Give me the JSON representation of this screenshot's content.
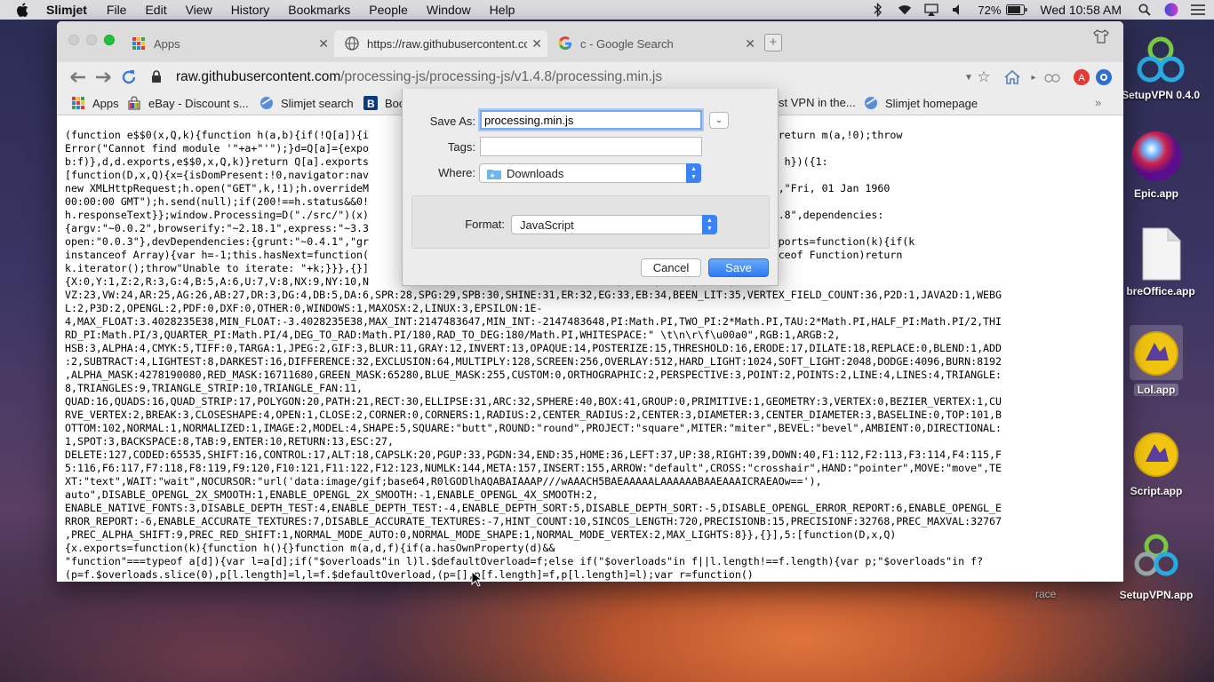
{
  "menubar": {
    "app_name": "Slimjet",
    "items": [
      "File",
      "Edit",
      "View",
      "History",
      "Bookmarks",
      "People",
      "Window",
      "Help"
    ],
    "battery": "72%",
    "clock": "Wed 10:58 AM"
  },
  "tabs": [
    {
      "title": "Apps",
      "icon": "apps-grid-icon"
    },
    {
      "title": "https://raw.githubusercontent.co",
      "icon": "globe-icon"
    },
    {
      "title": "c - Google Search",
      "icon": "google-icon"
    }
  ],
  "address": {
    "host": "raw.githubusercontent.com",
    "path": "/processing-js/processing-js/v1.4.8/processing.min.js"
  },
  "bookmarks": [
    {
      "label": "Apps",
      "icon": "apps-grid-icon"
    },
    {
      "label": "eBay - Discount s...",
      "icon": "ebay-icon"
    },
    {
      "label": "Slimjet search",
      "icon": "slimjet-icon"
    },
    {
      "label": "Boo",
      "icon": "booking-icon"
    },
    {
      "label": "st VPN in the...",
      "icon": "vpn-icon"
    },
    {
      "label": "Slimjet homepage",
      "icon": "slimjet-icon"
    }
  ],
  "code_text": "(function e$$0(x,Q,k){function h(a,b){if(!Q[a]){i                                        !b&&d)return d(a,!0);if(m)return m(a,!0);throw\nError(\"Cannot find module '\"+a+\"'\");}d=Q[a]={expo                                        l][f];return h(b?\nb:f)},d,d.exports,e$$0,x,Q,k)}return Q[a].exports                                        .length;n++)h(k[n]);return h})({1:\n[function(D,x,Q){x={isDomPresent:!0,navigator:nav                                        ){var h=\nnew XMLHttpRequest;h.open(\"GET\",k,!1);h.overrideM                                        Header(\"If-Modified-Since\",\"Fri, 01 Jan 1960\n00:00:00 GMT\");h.send(null);if(200!==h.status&&0!                                        h.status;return\nh.responseText}};window.Processing=D(\"./src/\")(x)                                        rocessing.js\",version:\"1.4.8\",dependencies:\n{argv:\"~0.0.2\",browserify:\"~2.18.1\",express:\"~3.3                                        \nopen:\"0.0.3\"},devDependencies:{grunt:\"~0.4.1\",\"gr                                        }],3:[function(D,x,Q){x.exports=function(k){if(k\ninstanceof Array){var h=-1;this.hasNext=function(                                        }else{if(k.iterator instanceof Function)return\nk.iterator();throw\"Unable to iterate: \"+k;}}},{}]\n{X:0,Y:1,Z:2,R:3,G:4,B:5,A:6,U:7,V:8,NX:9,NY:10,N                                        ,TZ:20,VX:21,VY:22,\nVZ:23,VW:24,AR:25,AG:26,AB:27,DR:3,DG:4,DB:5,DA:6,SPR:28,SPG:29,SPB:30,SHINE:31,ER:32,EG:33,EB:34,BEEN_LIT:35,VERTEX_FIELD_COUNT:36,P2D:1,JAVA2D:1,WEBG\nL:2,P3D:2,OPENGL:2,PDF:0,DXF:0,OTHER:0,WINDOWS:1,MAXOSX:2,LINUX:3,EPSILON:1E-\n4,MAX_FLOAT:3.4028235E38,MIN_FLOAT:-3.4028235E38,MAX_INT:2147483647,MIN_INT:-2147483648,PI:Math.PI,TWO_PI:2*Math.PI,TAU:2*Math.PI,HALF_PI:Math.PI/2,THI\nRD_PI:Math.PI/3,QUARTER_PI:Math.PI/4,DEG_TO_RAD:Math.PI/180,RAD_TO_DEG:180/Math.PI,WHITESPACE:\" \\t\\n\\r\\f\\u00a0\",RGB:1,ARGB:2,\nHSB:3,ALPHA:4,CMYK:5,TIFF:0,TARGA:1,JPEG:2,GIF:3,BLUR:11,GRAY:12,INVERT:13,OPAQUE:14,POSTERIZE:15,THRESHOLD:16,ERODE:17,DILATE:18,REPLACE:0,BLEND:1,ADD\n:2,SUBTRACT:4,LIGHTEST:8,DARKEST:16,DIFFERENCE:32,EXCLUSION:64,MULTIPLY:128,SCREEN:256,OVERLAY:512,HARD_LIGHT:1024,SOFT_LIGHT:2048,DODGE:4096,BURN:8192\n,ALPHA_MASK:4278190080,RED_MASK:16711680,GREEN_MASK:65280,BLUE_MASK:255,CUSTOM:0,ORTHOGRAPHIC:2,PERSPECTIVE:3,POINT:2,POINTS:2,LINE:4,LINES:4,TRIANGLE:\n8,TRIANGLES:9,TRIANGLE_STRIP:10,TRIANGLE_FAN:11,\nQUAD:16,QUADS:16,QUAD_STRIP:17,POLYGON:20,PATH:21,RECT:30,ELLIPSE:31,ARC:32,SPHERE:40,BOX:41,GROUP:0,PRIMITIVE:1,GEOMETRY:3,VERTEX:0,BEZIER_VERTEX:1,CU\nRVE_VERTEX:2,BREAK:3,CLOSESHAPE:4,OPEN:1,CLOSE:2,CORNER:0,CORNERS:1,RADIUS:2,CENTER_RADIUS:2,CENTER:3,DIAMETER:3,CENTER_DIAMETER:3,BASELINE:0,TOP:101,B\nOTTOM:102,NORMAL:1,NORMALIZED:1,IMAGE:2,MODEL:4,SHAPE:5,SQUARE:\"butt\",ROUND:\"round\",PROJECT:\"square\",MITER:\"miter\",BEVEL:\"bevel\",AMBIENT:0,DIRECTIONAL:\n1,SPOT:3,BACKSPACE:8,TAB:9,ENTER:10,RETURN:13,ESC:27,\nDELETE:127,CODED:65535,SHIFT:16,CONTROL:17,ALT:18,CAPSLK:20,PGUP:33,PGDN:34,END:35,HOME:36,LEFT:37,UP:38,RIGHT:39,DOWN:40,F1:112,F2:113,F3:114,F4:115,F\n5:116,F6:117,F7:118,F8:119,F9:120,F10:121,F11:122,F12:123,NUMLK:144,META:157,INSERT:155,ARROW:\"default\",CROSS:\"crosshair\",HAND:\"pointer\",MOVE:\"move\",TE\nXT:\"text\",WAIT:\"wait\",NOCURSOR:\"url('data:image/gif;base64,R0lGODlhAQABAIAAAP///wAAACH5BAEAAAAALAAAAAABAAEAAAICRAEAOw=='),\nauto\",DISABLE_OPENGL_2X_SMOOTH:1,ENABLE_OPENGL_2X_SMOOTH:-1,ENABLE_OPENGL_4X_SMOOTH:2,\nENABLE_NATIVE_FONTS:3,DISABLE_DEPTH_TEST:4,ENABLE_DEPTH_TEST:-4,ENABLE_DEPTH_SORT:5,DISABLE_DEPTH_SORT:-5,DISABLE_OPENGL_ERROR_REPORT:6,ENABLE_OPENGL_E\nRROR_REPORT:-6,ENABLE_ACCURATE_TEXTURES:7,DISABLE_ACCURATE_TEXTURES:-7,HINT_COUNT:10,SINCOS_LENGTH:720,PRECISIONB:15,PRECISIONF:32768,PREC_MAXVAL:32767\n,PREC_ALPHA_SHIFT:9,PREC_RED_SHIFT:1,NORMAL_MODE_AUTO:0,NORMAL_MODE_SHAPE:1,NORMAL_MODE_VERTEX:2,MAX_LIGHTS:8}},{}],5:[function(D,x,Q)\n{x.exports=function(k){function h(){}function m(a,d,f){if(a.hasOwnProperty(d)&&\n\"function\"===typeof a[d]){var l=a[d];if(\"$overloads\"in l)l.$defaultOverload=f;else if(\"$overloads\"in f||l.length!==f.length){var p;\"$overloads\"in f?\n(p=f.$overloads.slice(0),p[l.length]=l,l=f.$defaultOverload,(p=[],p[f.length]=f,p[l.length]=l);var r=function()",
  "dialog": {
    "save_as_label": "Save As:",
    "save_as_value": "processing.min.js",
    "tags_label": "Tags:",
    "tags_value": "",
    "where_label": "Where:",
    "where_value": "Downloads",
    "format_label": "Format:",
    "format_value": "JavaScript",
    "cancel_label": "Cancel",
    "save_label": "Save"
  },
  "desktop_icons": [
    {
      "label": "SetupVPN 0.4.0",
      "icon": "setupvpn-icon"
    },
    {
      "label": "Epic.app",
      "icon": "epic-browser-icon"
    },
    {
      "label": "breOffice.app",
      "icon": "libreoffice-icon"
    },
    {
      "label": "Lol.app",
      "icon": "script-app-icon"
    },
    {
      "label": "Script.app",
      "icon": "script-app-icon"
    },
    {
      "label": "SetupVPN.app",
      "icon": "setupvpn-icon"
    }
  ],
  "desktop_partial_label": "race"
}
